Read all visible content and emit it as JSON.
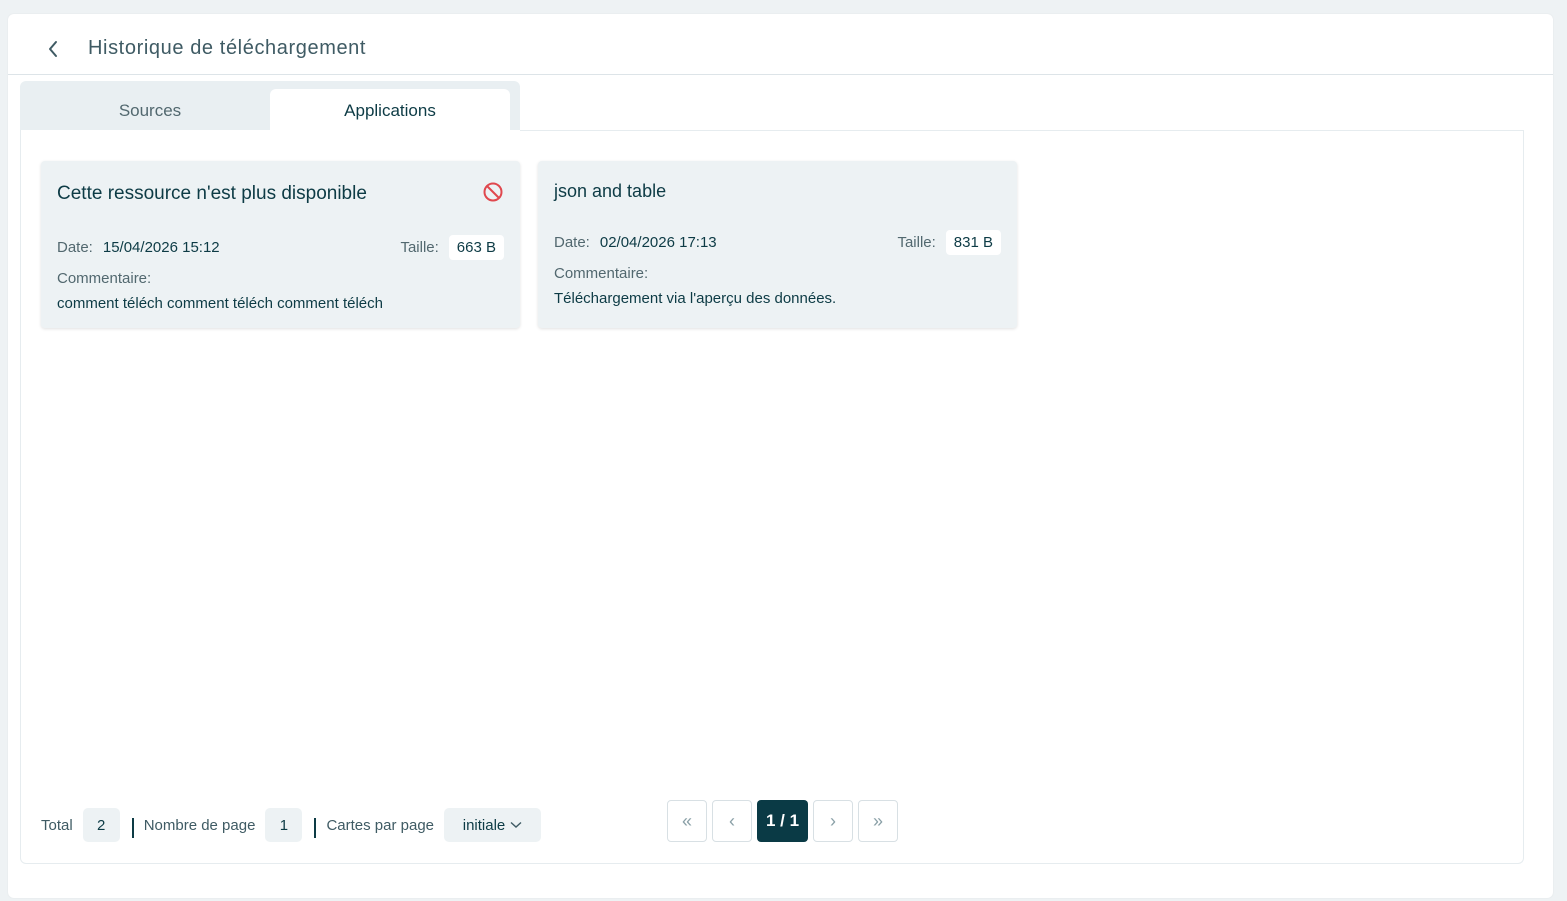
{
  "header": {
    "title": "Historique de téléchargement",
    "back_icon": "chevron-left-icon"
  },
  "tabs": [
    {
      "label": "Sources",
      "active": false
    },
    {
      "label": "Applications",
      "active": true
    }
  ],
  "cards": [
    {
      "title": "Cette ressource n'est plus disponible",
      "status_icon": "ban-icon",
      "date_label": "Date:",
      "date": "15/04/2026 15:12",
      "size_label": "Taille:",
      "size": "663 B",
      "comment_label": "Commentaire:",
      "comment": "comment téléch comment téléch comment téléch"
    },
    {
      "title": "json and table",
      "date_label": "Date:",
      "date": "02/04/2026 17:13",
      "size_label": "Taille:",
      "size": "831 B",
      "comment_label": "Commentaire:",
      "comment": "Téléchargement via l'aperçu des données."
    }
  ],
  "footer": {
    "total_label": "Total",
    "total": "2",
    "pages_label": "Nombre de page",
    "pages": "1",
    "per_page_label": "Cartes par page",
    "per_page_value": "initiale"
  },
  "pagination": {
    "first": "«",
    "prev": "‹",
    "current": "1 / 1",
    "next": "›",
    "last": "»"
  },
  "colors": {
    "accent": "#0a3a45",
    "danger": "#e0484e",
    "card_bg": "#edf2f4"
  }
}
